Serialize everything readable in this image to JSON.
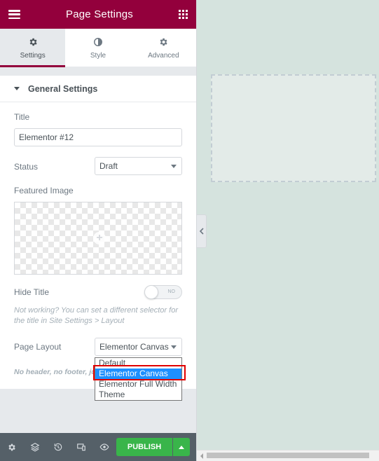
{
  "header": {
    "title": "Page Settings"
  },
  "tabs": [
    {
      "label": "Settings",
      "icon": "gear-icon",
      "active": true
    },
    {
      "label": "Style",
      "icon": "half-circle-icon",
      "active": false
    },
    {
      "label": "Advanced",
      "icon": "gear-icon",
      "active": false
    }
  ],
  "general": {
    "heading": "General Settings",
    "title_label": "Title",
    "title_value": "Elementor #12",
    "status_label": "Status",
    "status_value": "Draft",
    "featured_label": "Featured Image",
    "hide_title_label": "Hide Title",
    "hide_title_toggle": "NO",
    "note": "Not working? You can set a different selector for the title in Site Settings > Layout",
    "page_layout_label": "Page Layout",
    "page_layout_value": "Elementor Canvas",
    "layout_note": "No header, no footer, just",
    "layout_options": [
      "Default",
      "Elementor Canvas",
      "Elementor Full Width",
      "Theme"
    ],
    "layout_selected_index": 1
  },
  "footer": {
    "publish_label": "PUBLISH"
  },
  "colors": {
    "brand": "#93003c",
    "publish": "#39b54a",
    "footer": "#556068",
    "canvas": "#d5e3de",
    "selection": "#1e90ff",
    "highlight": "#e00000"
  }
}
